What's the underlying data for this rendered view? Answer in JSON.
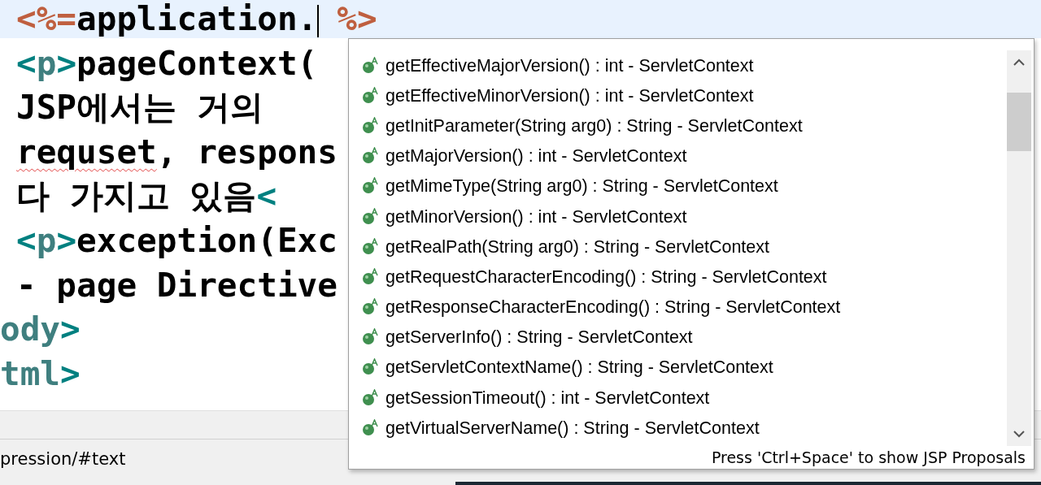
{
  "editor": {
    "lines": [
      {
        "current": true,
        "segments": [
          {
            "kind": "jsp",
            "text": "<%="
          },
          {
            "kind": "text",
            "text": "application."
          },
          {
            "kind": "caret"
          },
          {
            "kind": "jsp",
            "text": "%>"
          }
        ]
      },
      {
        "current": false,
        "segments": [
          {
            "kind": "tag",
            "text": "<"
          },
          {
            "kind": "tagname",
            "text": "p"
          },
          {
            "kind": "tag",
            "text": ">"
          },
          {
            "kind": "text",
            "text": "pageContext("
          }
        ]
      },
      {
        "current": false,
        "segments": [
          {
            "kind": "text",
            "text": "JSP에서는 거의"
          }
        ]
      },
      {
        "current": false,
        "segments": [
          {
            "kind": "misspelled",
            "text": "requset"
          },
          {
            "kind": "text",
            "text": ", respons"
          }
        ]
      },
      {
        "current": false,
        "segments": [
          {
            "kind": "text",
            "text": "다 가지고 있음"
          },
          {
            "kind": "tag",
            "text": "<"
          }
        ]
      },
      {
        "current": false,
        "segments": [
          {
            "kind": "tag",
            "text": "<"
          },
          {
            "kind": "tagname",
            "text": "p"
          },
          {
            "kind": "tag",
            "text": ">"
          },
          {
            "kind": "text",
            "text": "exception(Exc"
          }
        ]
      },
      {
        "current": false,
        "segments": [
          {
            "kind": "text",
            "text": "- page Directive"
          }
        ]
      },
      {
        "current": false,
        "outdent": true,
        "segments": [
          {
            "kind": "tagname",
            "text": "ody"
          },
          {
            "kind": "tag",
            "text": ">"
          }
        ]
      },
      {
        "current": false,
        "outdent": true,
        "segments": [
          {
            "kind": "tagname",
            "text": "tml"
          },
          {
            "kind": "tag",
            "text": ">"
          }
        ]
      }
    ]
  },
  "status_bar": {
    "path": "pression/#text"
  },
  "proposals": {
    "items": [
      {
        "label": "getEffectiveMajorVersion() : int - ServletContext"
      },
      {
        "label": "getEffectiveMinorVersion() : int - ServletContext"
      },
      {
        "label": "getInitParameter(String arg0) : String - ServletContext"
      },
      {
        "label": "getMajorVersion() : int - ServletContext"
      },
      {
        "label": "getMimeType(String arg0) : String - ServletContext"
      },
      {
        "label": "getMinorVersion() : int - ServletContext"
      },
      {
        "label": "getRealPath(String arg0) : String - ServletContext"
      },
      {
        "label": "getRequestCharacterEncoding() : String - ServletContext"
      },
      {
        "label": "getResponseCharacterEncoding() : String - ServletContext"
      },
      {
        "label": "getServerInfo() : String - ServletContext"
      },
      {
        "label": "getServletContextName() : String - ServletContext"
      },
      {
        "label": "getSessionTimeout() : int - ServletContext"
      },
      {
        "label": "getVirtualServerName() : String - ServletContext"
      }
    ],
    "hint": "Press 'Ctrl+Space' to show JSP Proposals"
  }
}
